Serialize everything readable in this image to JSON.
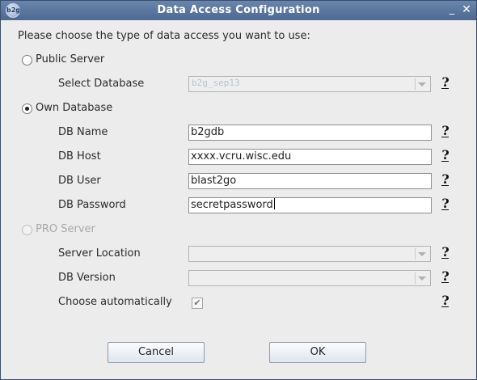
{
  "window": {
    "title": "Data Access Configuration",
    "app_icon_text": "b2g",
    "minimize_glyph": "_",
    "close_glyph": "✕"
  },
  "prompt": "Please choose the type of data access you want to use:",
  "public_server": {
    "label": "Public Server",
    "selected": false,
    "select_database_label": "Select Database",
    "select_database_value": "b2g_sep13"
  },
  "own_database": {
    "label": "Own Database",
    "selected": true,
    "fields": {
      "db_name": {
        "label": "DB Name",
        "value": "b2gdb"
      },
      "db_host": {
        "label": "DB Host",
        "value": "xxxx.vcru.wisc.edu"
      },
      "db_user": {
        "label": "DB User",
        "value": "blast2go"
      },
      "db_password": {
        "label": "DB Password",
        "value": "secretpassword"
      }
    }
  },
  "pro_server": {
    "label": "PRO Server",
    "selected": false,
    "enabled": false,
    "server_location_label": "Server Location",
    "server_location_value": "",
    "db_version_label": "DB Version",
    "db_version_value": "",
    "choose_automatically_label": "Choose automatically",
    "choose_automatically_checked": true
  },
  "help_glyph": "?",
  "checkmark_glyph": "✔",
  "buttons": {
    "cancel": "Cancel",
    "ok": "OK"
  }
}
